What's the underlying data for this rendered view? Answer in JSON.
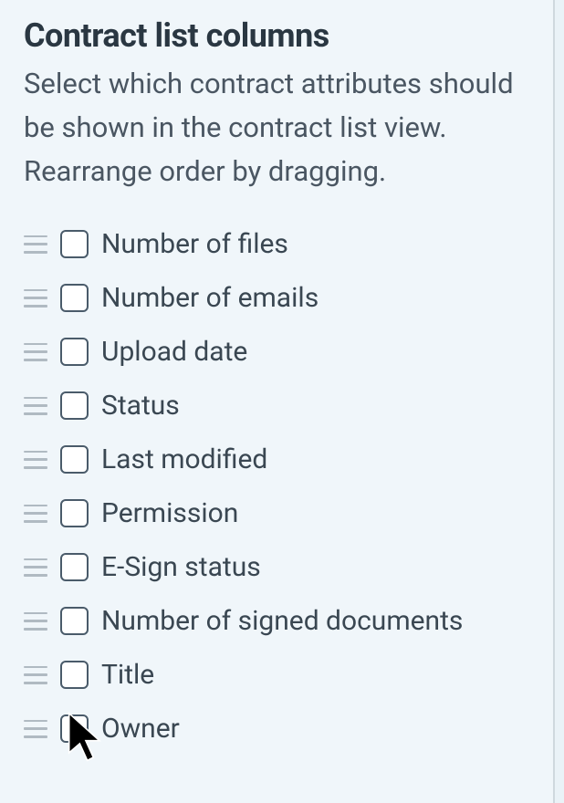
{
  "header": {
    "title": "Contract list columns",
    "description": "Select which contract attributes should be shown in the contract list view. Rearrange order by dragging."
  },
  "columns": [
    {
      "label": "Number of files",
      "checked": false
    },
    {
      "label": "Number of emails",
      "checked": false
    },
    {
      "label": "Upload date",
      "checked": false
    },
    {
      "label": "Status",
      "checked": false
    },
    {
      "label": "Last modified",
      "checked": false
    },
    {
      "label": "Permission",
      "checked": false
    },
    {
      "label": "E-Sign status",
      "checked": false
    },
    {
      "label": "Number of signed documents",
      "checked": false
    },
    {
      "label": "Title",
      "checked": false
    },
    {
      "label": "Owner",
      "checked": false
    }
  ]
}
